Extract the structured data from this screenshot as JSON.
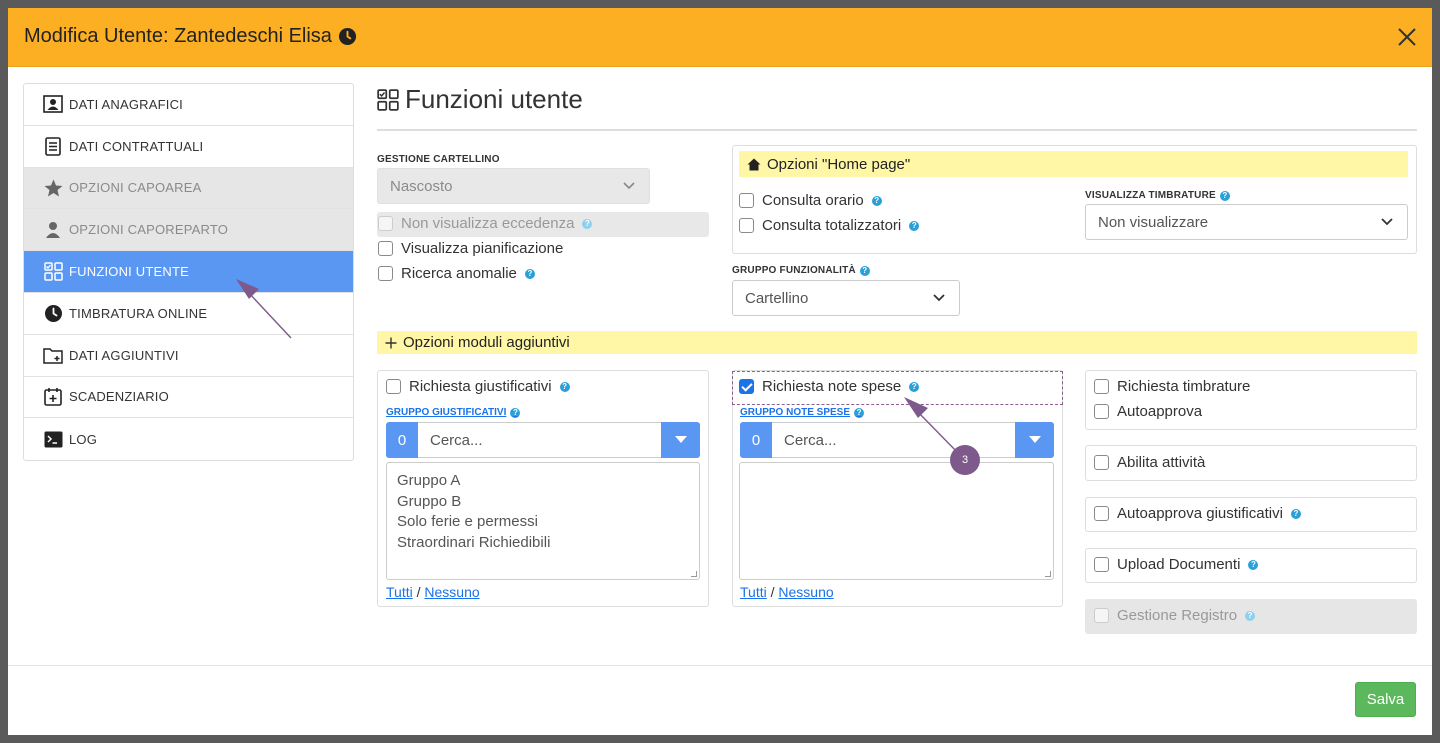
{
  "header": {
    "title": "Modifica Utente: Zantedeschi Elisa"
  },
  "sidebar": {
    "items": [
      {
        "label": "DATI ANAGRAFICI"
      },
      {
        "label": "DATI CONTRATTUALI"
      },
      {
        "label": "OPZIONI CAPOAREA"
      },
      {
        "label": "OPZIONI CAPOREPARTO"
      },
      {
        "label": "FUNZIONI UTENTE"
      },
      {
        "label": "TIMBRATURA ONLINE"
      },
      {
        "label": "DATI AGGIUNTIVI"
      },
      {
        "label": "SCADENZIARIO"
      },
      {
        "label": "LOG"
      }
    ]
  },
  "main": {
    "title": "Funzioni utente",
    "gestione_cartellino": {
      "label": "GESTIONE CARTELLINO",
      "value": "Nascosto",
      "non_visualizza_eccedenza": "Non visualizza eccedenza",
      "visualizza_pianificazione": "Visualizza pianificazione",
      "ricerca_anomalie": "Ricerca anomalie"
    },
    "home_page": {
      "title": "Opzioni \"Home page\"",
      "consulta_orario": "Consulta orario",
      "consulta_totalizzatori": "Consulta totalizzatori",
      "visualizza_timbrature_label": "VISUALIZZA TIMBRATURE",
      "visualizza_timbrature_value": "Non visualizzare"
    },
    "gruppo_funzionalita": {
      "label": "GRUPPO FUNZIONALITÀ",
      "value": "Cartellino"
    },
    "moduli": {
      "title": "Opzioni moduli aggiuntivi",
      "giustificativi": {
        "checkbox": "Richiesta giustificativi",
        "group_label": "GRUPPO GIUSTIFICATIVI",
        "count": "0",
        "search_placeholder": "Cerca...",
        "items": [
          "Gruppo A",
          "Gruppo B",
          "Solo ferie e permessi",
          "Straordinari Richiedibili"
        ],
        "all": "Tutti",
        "sep": "/",
        "none": "Nessuno"
      },
      "note_spese": {
        "checkbox": "Richiesta note spese",
        "group_label": "GRUPPO NOTE SPESE",
        "count": "0",
        "search_placeholder": "Cerca...",
        "all": "Tutti",
        "sep": "/",
        "none": "Nessuno"
      },
      "right": {
        "richiesta_timbrature": "Richiesta timbrature",
        "autoapprova": "Autoapprova",
        "abilita_attivita": "Abilita attività",
        "autoapprova_giustificativi": "Autoapprova giustificativi",
        "upload_documenti": "Upload Documenti",
        "gestione_registro": "Gestione Registro"
      }
    }
  },
  "annotation": {
    "marker": "3"
  },
  "footer": {
    "save_label": "Salva"
  },
  "colors": {
    "header": "#fcaf23",
    "active": "#5a97f2",
    "save": "#5cb85c",
    "highlight": "#fff7a6"
  }
}
